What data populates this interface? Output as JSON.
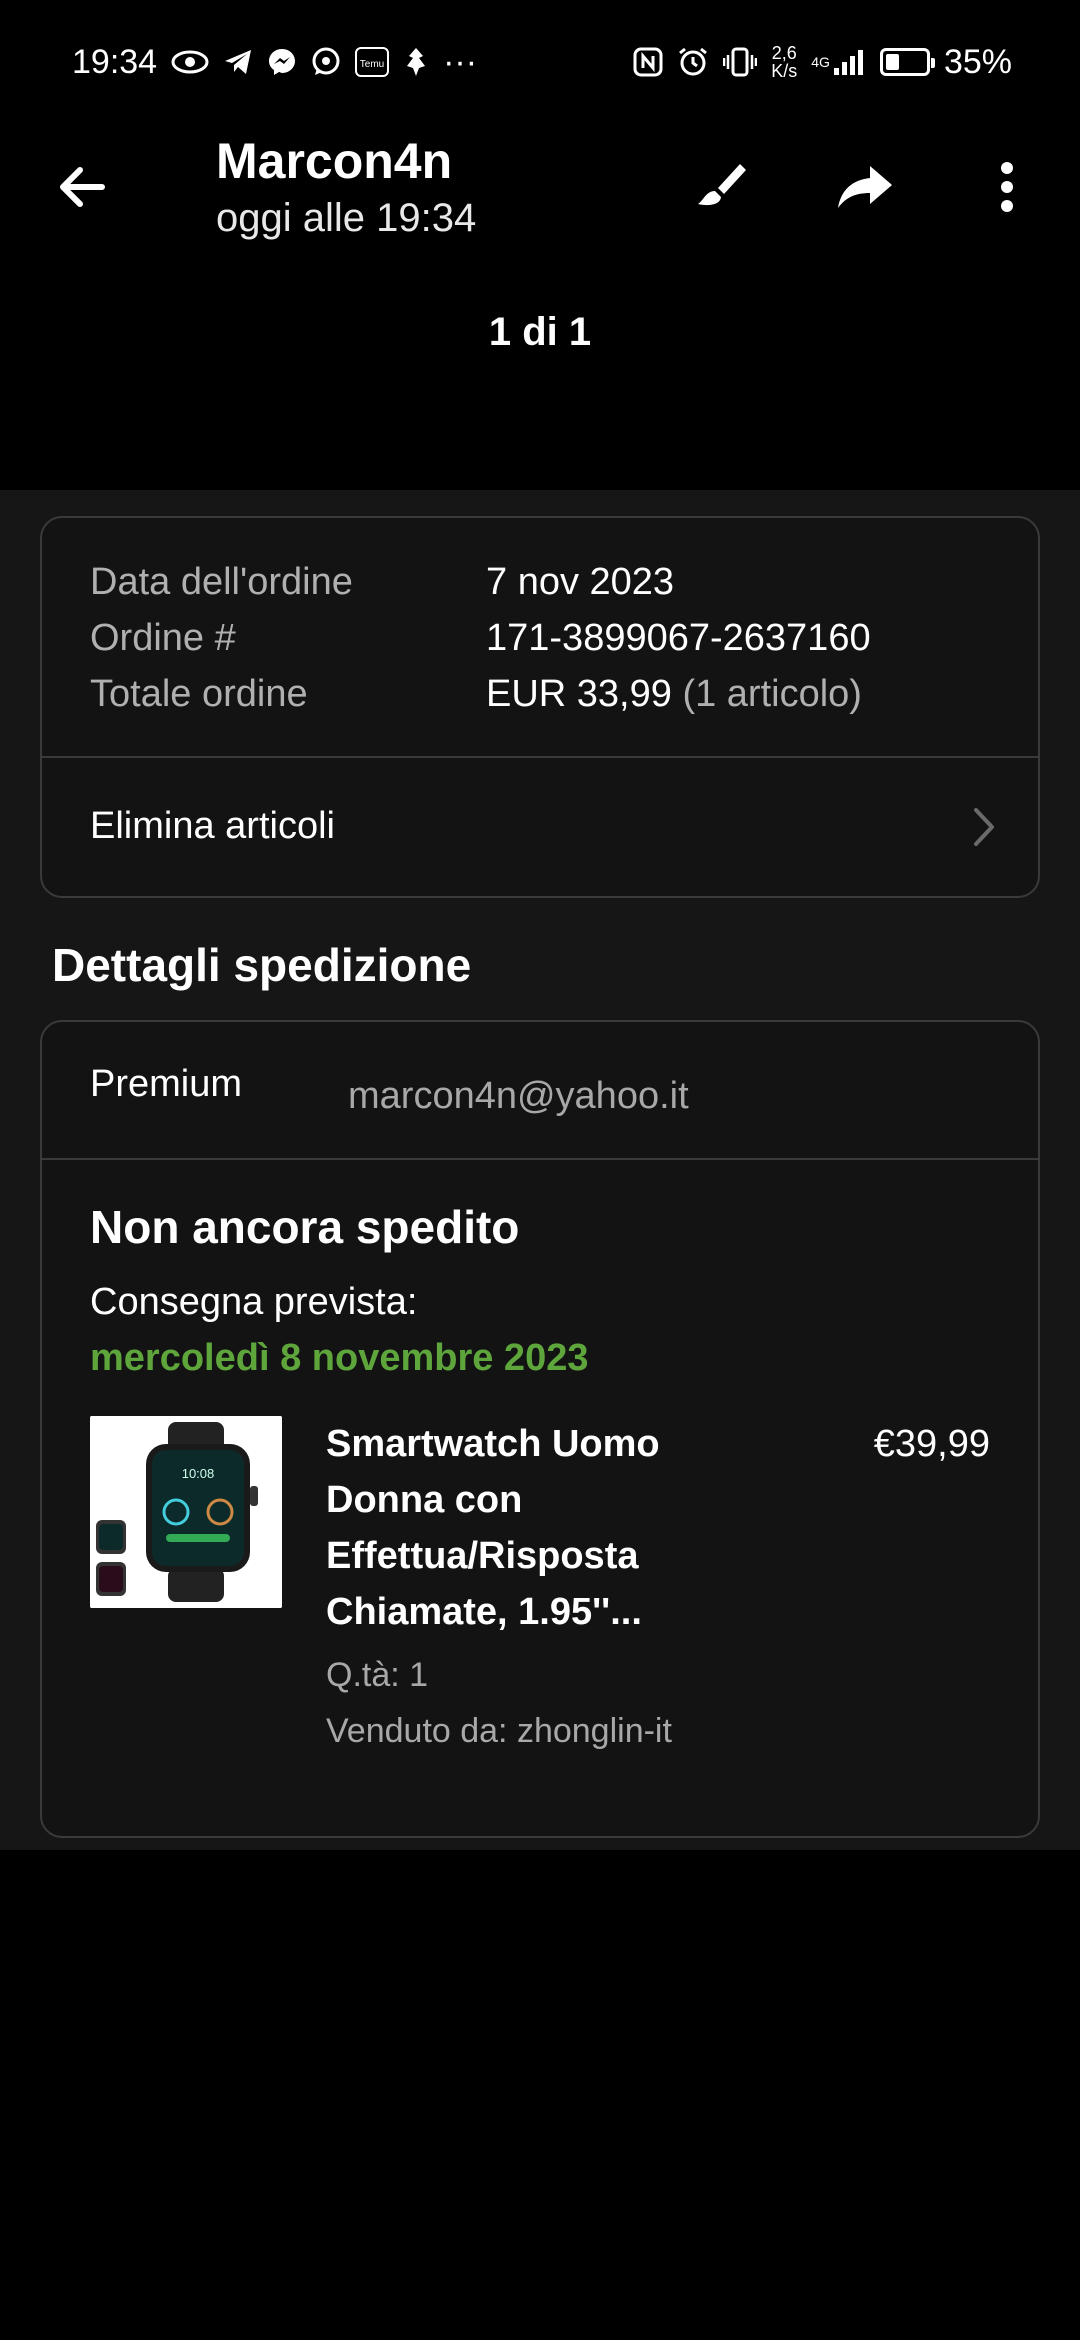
{
  "status_bar": {
    "time": "19:34",
    "temu_icon_text": "Temu",
    "overflow": "···",
    "network_speed_value": "2,6",
    "network_speed_unit": "K/s",
    "network_type": "4G",
    "battery_percent": "35%",
    "battery_level": 0.35
  },
  "header": {
    "sender": "Marcon4n",
    "time": "oggi alle 19:34",
    "page_count": "1 di 1"
  },
  "order": {
    "rows": [
      {
        "label": "Data dell'ordine",
        "value": "7 nov 2023"
      },
      {
        "label": "Ordine #",
        "value": "171-3899067-2637160"
      },
      {
        "label": "Totale ordine",
        "value": "EUR 33,99",
        "suffix": "(1 articolo)"
      }
    ],
    "delete_label": "Elimina articoli"
  },
  "shipping": {
    "section_title": "Dettagli spedizione",
    "plan": "Premium",
    "email": "marcon4n@yahoo.it",
    "status": "Non ancora spedito",
    "delivery_label": "Consegna prevista:",
    "delivery_date": "mercoledì 8 novembre 2023",
    "delivery_color": "#5ea63c",
    "product": {
      "title": "Smartwatch Uomo Donna con Effettua/Risposta Chiamate, 1.95''...",
      "price": "€39,99",
      "qty": "Q.tà: 1",
      "seller": "Venduto da: zhonglin-it",
      "watch_face_time": "10:08"
    }
  }
}
